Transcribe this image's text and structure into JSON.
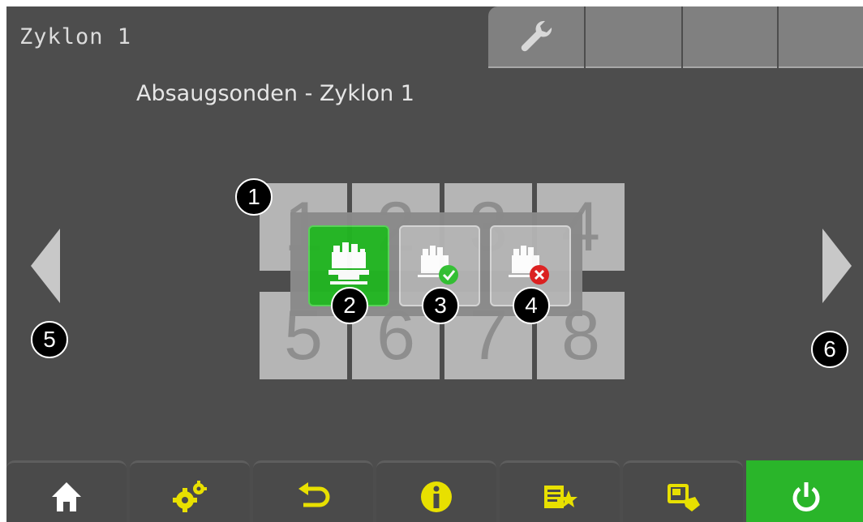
{
  "header": {
    "title": "Zyklon 1"
  },
  "tabs": [
    {
      "icon": "wrench-icon"
    },
    {
      "icon": ""
    },
    {
      "icon": ""
    },
    {
      "icon": ""
    }
  ],
  "page": {
    "subtitle": "Absaugsonden - Zyklon 1"
  },
  "grid": {
    "tiles": [
      "1",
      "2",
      "3",
      "4",
      "5",
      "6",
      "7",
      "8"
    ]
  },
  "popup": {
    "buttons": [
      {
        "icon": "probe-active-icon",
        "active": true,
        "color": "#22b522"
      },
      {
        "icon": "probe-check-icon",
        "active": false
      },
      {
        "icon": "probe-cross-icon",
        "active": false
      }
    ]
  },
  "annotations": [
    "1",
    "2",
    "3",
    "4",
    "5",
    "6"
  ],
  "navigation": {
    "prev_icon": "triangle-left-icon",
    "next_icon": "triangle-right-icon"
  },
  "bottom_bar": [
    {
      "icon": "home-icon"
    },
    {
      "icon": "gears-icon"
    },
    {
      "icon": "back-arrow-icon"
    },
    {
      "icon": "info-icon"
    },
    {
      "icon": "favorites-list-icon"
    },
    {
      "icon": "screen-touch-icon"
    },
    {
      "icon": "power-icon",
      "color": "#2ab52a"
    }
  ],
  "colors": {
    "background": "#4d4d4d",
    "accent_yellow": "#e8e000",
    "accent_green": "#22b522",
    "status_check": "#33c233",
    "status_cross": "#e02020"
  }
}
